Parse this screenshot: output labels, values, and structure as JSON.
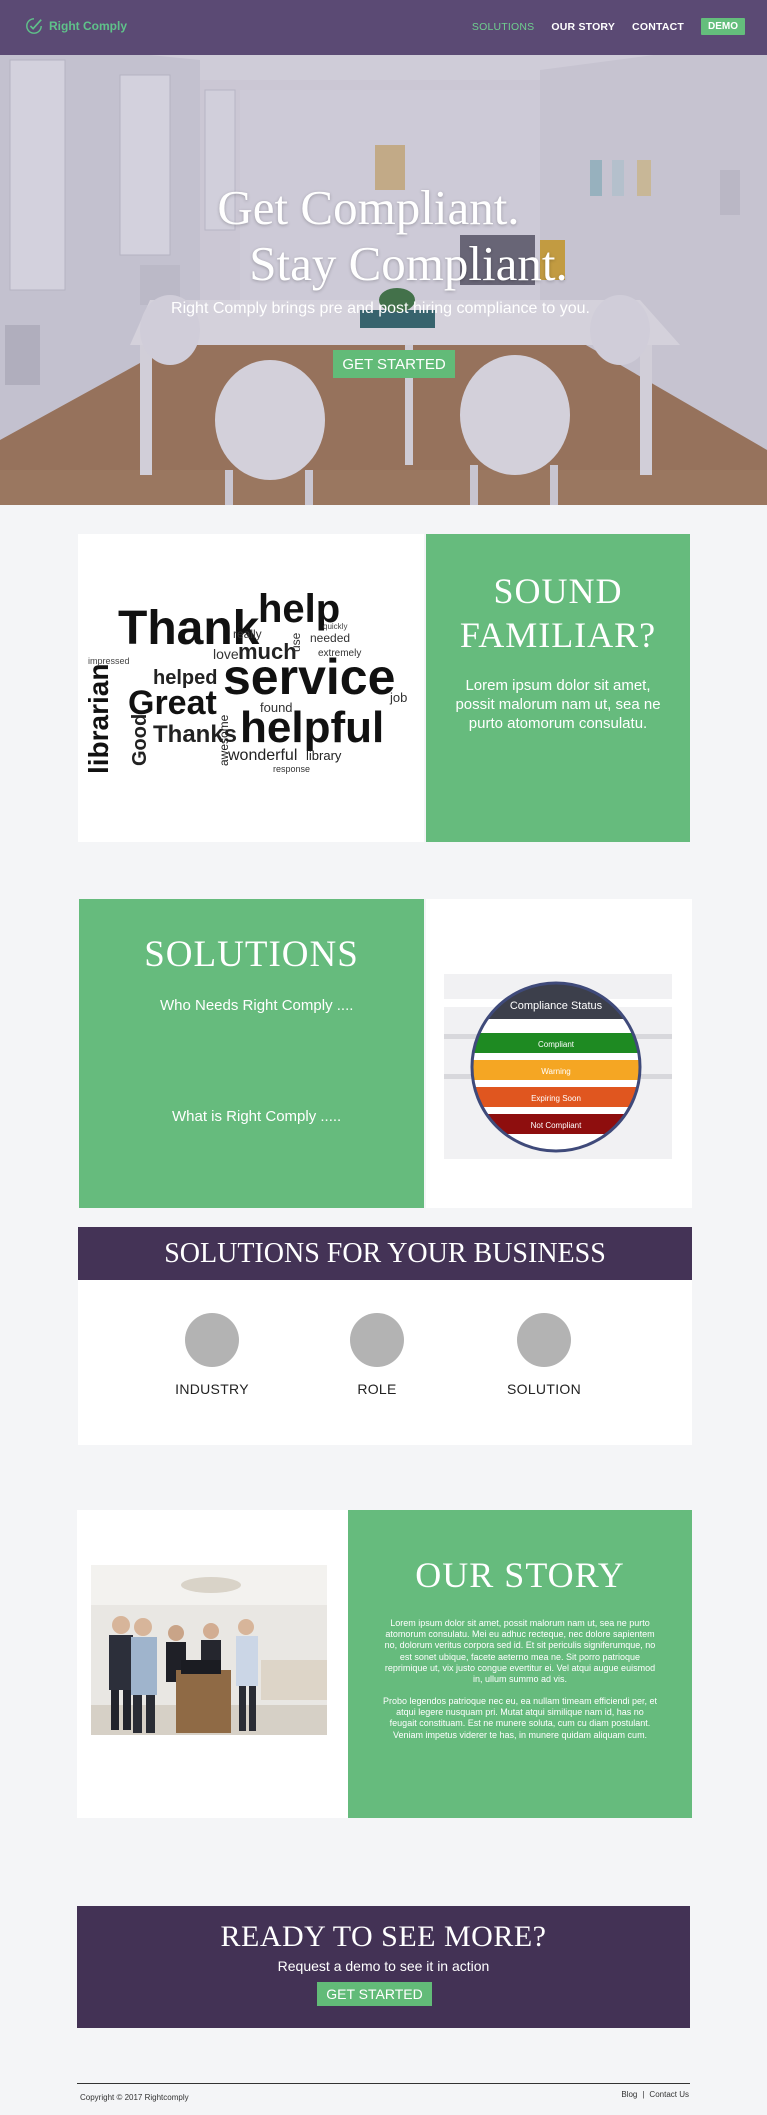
{
  "nav": {
    "brand": "Right Comply",
    "links": [
      "SOLUTIONS",
      "OUR STORY",
      "CONTACT"
    ],
    "demo": "DEMO"
  },
  "hero": {
    "title_line1": "Get Compliant.",
    "title_line2": "Stay Compliant.",
    "subtitle": "Right Comply brings pre and post hiring compliance to you.",
    "cta": "GET STARTED"
  },
  "sound_familiar": {
    "heading_line1": "SOUND",
    "heading_line2": "FAMILIAR?",
    "body": "Lorem ipsum dolor sit amet, possit malorum nam ut, sea ne purto atomorum consulatu."
  },
  "word_cloud": {
    "words": [
      "Thank",
      "help",
      "service",
      "helpful",
      "much",
      "Great",
      "Thanks",
      "librarian",
      "Good",
      "helped",
      "love",
      "wonderful",
      "library",
      "awesome",
      "needed",
      "really",
      "found",
      "response",
      "extremely",
      "use",
      "job",
      "impressed",
      "quickly"
    ]
  },
  "solutions": {
    "heading": "SOLUTIONS",
    "line1": "Who Needs Right Comply ....",
    "line2": "What is Right Comply  ....."
  },
  "compliance_status": {
    "title": "Compliance Status",
    "rows": [
      {
        "label": "Compliant",
        "color": "#1e8a22"
      },
      {
        "label": "Warning",
        "color": "#f5a623"
      },
      {
        "label": "Expiring Soon",
        "color": "#e0561f"
      },
      {
        "label": "Not Compliant",
        "color": "#8e0e0e"
      }
    ]
  },
  "business": {
    "heading": "SOLUTIONS FOR YOUR BUSINESS",
    "items": [
      "INDUSTRY",
      "ROLE",
      "SOLUTION"
    ]
  },
  "story": {
    "heading": "OUR STORY",
    "para1": "Lorem ipsum dolor sit amet, possit malorum nam ut, sea ne purto atomorum consulatu. Mei eu adhuc recteque, nec dolore sapientem no, dolorum veritus corpora sed id. Et sit periculis signiferumque, no est sonet ubique, facete aeterno mea ne. Sit porro patrioque reprimique ut, vix justo congue evertitur ei. Vel atqui augue euismod in, ullum summo ad vis.",
    "para2": "Probo legendos patrioque nec eu, ea nullam timeam efficiendi per, et atqui legere nusquam pri. Mutat atqui similique nam id, has no feugait constituam. Est ne munere soluta, cum cu diam postulant. Veniam impetus viderer te has, in munere quidam aliquam cum."
  },
  "cta": {
    "heading": "READY TO SEE MORE?",
    "sub": "Request a demo to see it in action",
    "button": "GET STARTED"
  },
  "footer": {
    "copyright": "Copyright © 2017 Rightcomply",
    "links": [
      "Blog",
      "Contact Us"
    ],
    "separator": "|"
  },
  "colors": {
    "brand_purple": "#5b4a74",
    "dark_purple": "#443356",
    "green": "#66bb7d"
  }
}
